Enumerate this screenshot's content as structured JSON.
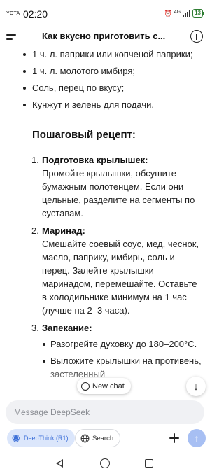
{
  "status_bar": {
    "carrier": "YOTA",
    "time": "02:20",
    "network": "4G",
    "battery": "13",
    "icons": [
      "alarm-icon",
      "signal-icon",
      "battery-icon"
    ]
  },
  "header": {
    "title": "Как вкусно приготовить с...",
    "icons": [
      "menu-icon",
      "new-chat-plus-icon"
    ]
  },
  "ingredients": [
    "1 ч. л. паприки или копченой паприки;",
    "1 ч. л. молотого имбиря;",
    "Соль, перец по вкусу;",
    "Кунжут и зелень для подачи."
  ],
  "recipe": {
    "heading": "Пошаговый рецепт:",
    "steps": [
      {
        "number": "1.",
        "title": "Подготовка крылышек:",
        "text": "Промойте крылышки, обсушите бумажным полотенцем. Если они цельные, разделите на сегменты по суставам."
      },
      {
        "number": "2.",
        "title": "Маринад:",
        "text": "Смешайте соевый соус, мед, чеснок, масло, паприку, имбирь, соль и перец. Залейте крылышки маринадом, перемешайте. Оставьте в холодильнике минимум на 1 час (лучше на 2–3 часа)."
      },
      {
        "number": "3.",
        "title": "Запекание:",
        "bullets": [
          "Разогрейте духовку до 180–200°C.",
          "Выложите крылышки на противень, застеленный"
        ]
      }
    ]
  },
  "new_chat_chip": {
    "label": "New chat",
    "icon": "plus-circle-icon"
  },
  "scroll_button": {
    "glyph": "↓",
    "icon": "arrow-down-icon"
  },
  "composer": {
    "placeholder": "Message DeepSeek",
    "value": ""
  },
  "toolbar": {
    "deepthink_label": "DeepThink (R1)",
    "search_label": "Search",
    "send_glyph": "↑",
    "icons": [
      "atom-icon",
      "globe-icon",
      "attach-plus-icon",
      "send-arrow-icon"
    ]
  },
  "nav_bar": {
    "icons": [
      "nav-back-icon",
      "nav-home-icon",
      "nav-recents-icon"
    ]
  },
  "colors": {
    "accent": "#3b6fd8",
    "deepthink_bg": "#dbe6fb",
    "send_button": "#a7bff3",
    "battery": "#2e7d32",
    "composer_bg": "#f0f1f4"
  }
}
